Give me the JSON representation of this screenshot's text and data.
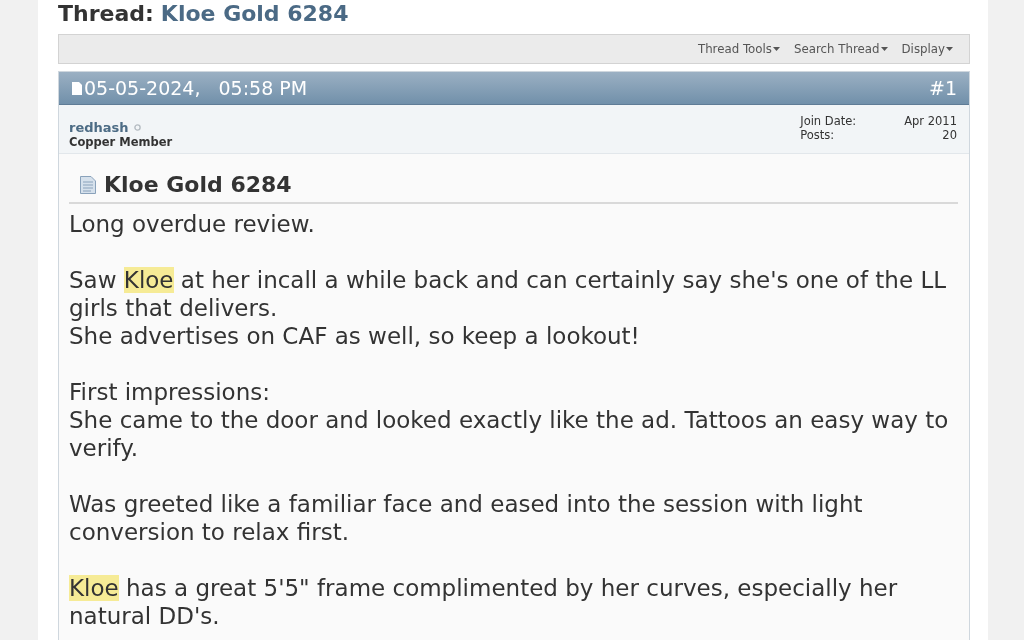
{
  "page_title": {
    "label": "Thread:",
    "thread_name": "Kloe Gold 6284"
  },
  "toolbar": {
    "items": [
      {
        "label": "Thread Tools"
      },
      {
        "label": "Search Thread"
      },
      {
        "label": "Display"
      }
    ]
  },
  "post": {
    "date": "05-05-2024,",
    "time": "05:58 PM",
    "number": "#1",
    "author": {
      "name": "redhash",
      "online": false,
      "rank": "Copper Member"
    },
    "stats": [
      {
        "label": "Join Date:",
        "value": "Apr 2011"
      },
      {
        "label": "Posts:",
        "value": "20"
      }
    ],
    "title": "Kloe Gold 6284",
    "message": [
      {
        "lines": [
          [
            {
              "text": "Long overdue review.",
              "highlighted": false
            }
          ]
        ]
      },
      {
        "lines": [
          [
            {
              "text": "Saw ",
              "highlighted": false
            },
            {
              "text": "Kloe",
              "highlighted": true
            },
            {
              "text": " at her incall a while back and can certainly say she's one of the LL girls that delivers.",
              "highlighted": false
            }
          ],
          [
            {
              "text": "She advertises on CAF as well, so keep a lookout!",
              "highlighted": false
            }
          ]
        ]
      },
      {
        "lines": [
          [
            {
              "text": "First impressions:",
              "highlighted": false
            }
          ],
          [
            {
              "text": "She came to the door and looked exactly like the ad. Tattoos an easy way to verify.",
              "highlighted": false
            }
          ]
        ]
      },
      {
        "lines": [
          [
            {
              "text": "Was greeted like a familiar face and eased into the session with light conversion to relax first.",
              "highlighted": false
            }
          ]
        ]
      },
      {
        "lines": [
          [
            {
              "text": "Kloe",
              "highlighted": true
            },
            {
              "text": " has a great 5'5\" frame complimented by her curves, especially her natural DD's.",
              "highlighted": false
            }
          ]
        ]
      }
    ]
  }
}
